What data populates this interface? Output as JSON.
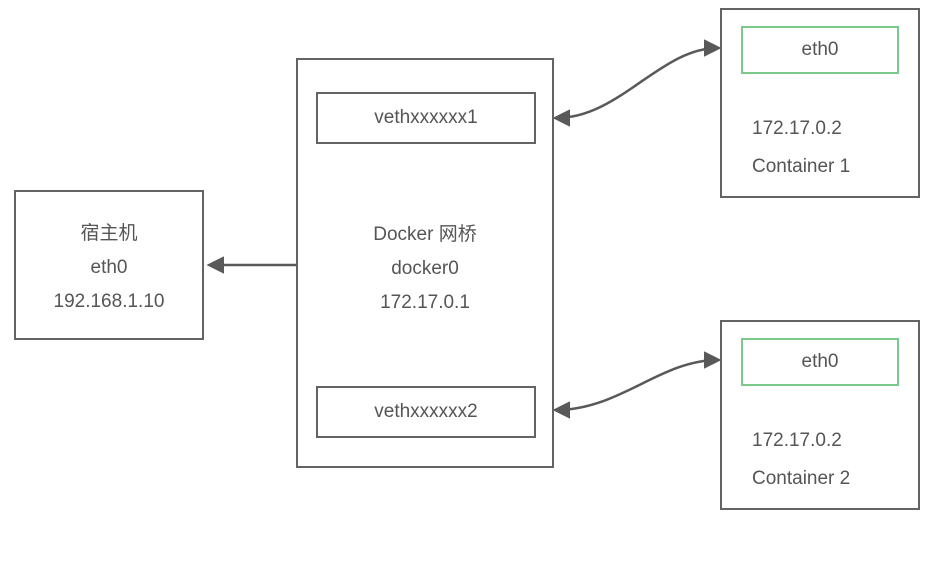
{
  "host": {
    "title": "宿主机",
    "iface": "eth0",
    "ip": "192.168.1.10"
  },
  "bridge": {
    "title": "Docker 网桥",
    "name": "docker0",
    "ip": "172.17.0.1",
    "veth1": "vethxxxxxx1",
    "veth2": "vethxxxxxx2"
  },
  "container1": {
    "iface": "eth0",
    "ip": "172.17.0.2",
    "label": "Container  1"
  },
  "container2": {
    "iface": "eth0",
    "ip": "172.17.0.2",
    "label": "Container  2"
  }
}
